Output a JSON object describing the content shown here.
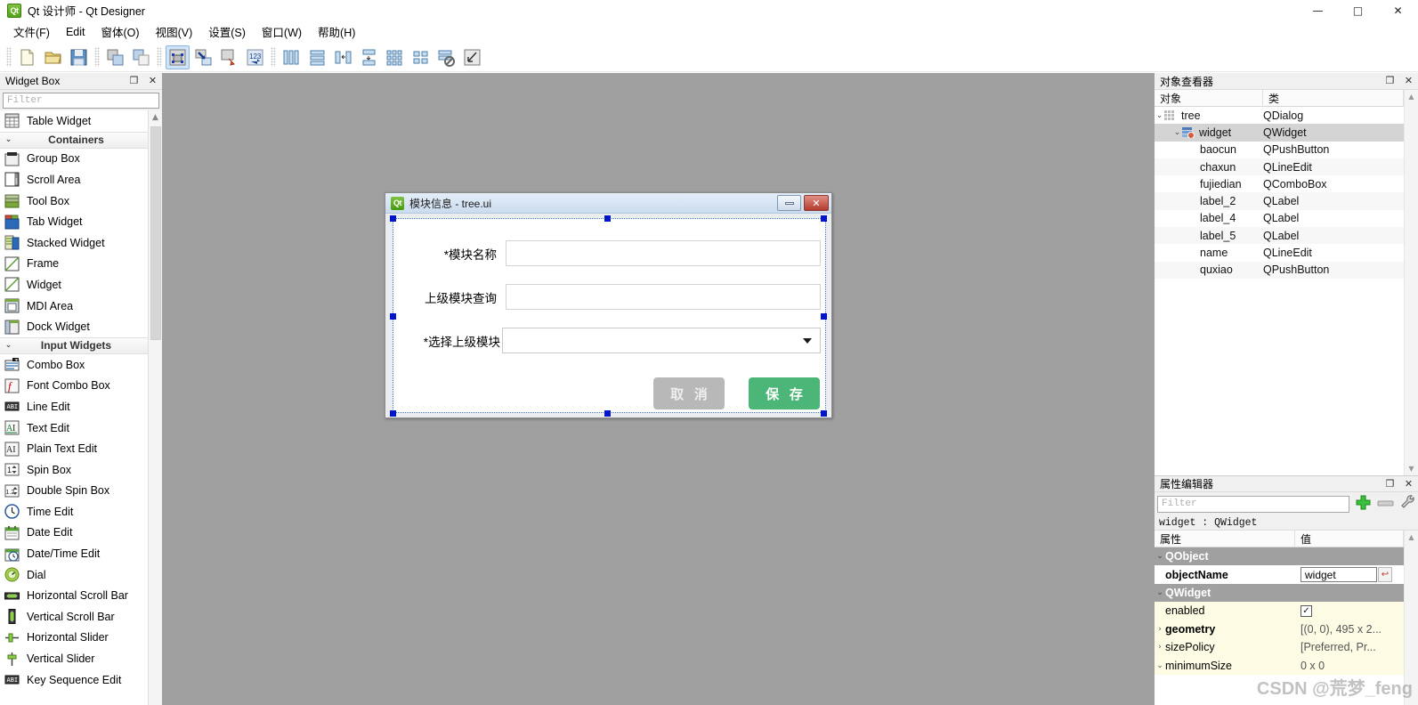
{
  "window": {
    "title": "Qt 设计师 - Qt Designer",
    "icon": "qt-logo-icon",
    "controls": {
      "minimize": "—",
      "maximize": "□",
      "close": "✕"
    }
  },
  "menubar": [
    {
      "label": "文件(F)"
    },
    {
      "label": "Edit"
    },
    {
      "label": "窗体(O)"
    },
    {
      "label": "视图(V)"
    },
    {
      "label": "设置(S)"
    },
    {
      "label": "窗口(W)"
    },
    {
      "label": "帮助(H)"
    }
  ],
  "toolbar": {
    "groups": [
      {
        "icons": [
          "new-file-icon",
          "open-folder-icon",
          "save-icon"
        ]
      },
      {
        "icons": [
          "copy-icon",
          "paste-icon"
        ]
      },
      {
        "icons": [
          "edit-widgets-icon",
          "edit-signals-slots-icon",
          "edit-buddies-icon",
          "edit-tab-order-icon"
        ]
      },
      {
        "icons": [
          "layout-horizontally-icon",
          "layout-vertically-icon",
          "layout-in-splitter-h-icon",
          "layout-in-splitter-v-icon",
          "layout-grid-icon",
          "layout-form-icon",
          "break-layout-icon",
          "adjust-size-icon"
        ]
      }
    ],
    "active_icon": "edit-widgets-icon"
  },
  "widget_box": {
    "title": "Widget Box",
    "float_label": "❐",
    "close_label": "✕",
    "filter_placeholder": "Filter",
    "items": [
      {
        "label": "Table Widget",
        "icon": "table-widget-icon",
        "type": "item"
      },
      {
        "label": "Containers",
        "icon": "chevron-down-icon",
        "type": "category"
      },
      {
        "label": "Group Box",
        "icon": "group-box-icon",
        "type": "item"
      },
      {
        "label": "Scroll Area",
        "icon": "scroll-area-icon",
        "type": "item"
      },
      {
        "label": "Tool Box",
        "icon": "tool-box-icon",
        "type": "item"
      },
      {
        "label": "Tab Widget",
        "icon": "tab-widget-icon",
        "type": "item"
      },
      {
        "label": "Stacked Widget",
        "icon": "stacked-widget-icon",
        "type": "item"
      },
      {
        "label": "Frame",
        "icon": "frame-icon",
        "type": "item"
      },
      {
        "label": "Widget",
        "icon": "widget-icon",
        "type": "item"
      },
      {
        "label": "MDI Area",
        "icon": "mdi-area-icon",
        "type": "item"
      },
      {
        "label": "Dock Widget",
        "icon": "dock-widget-icon",
        "type": "item"
      },
      {
        "label": "Input Widgets",
        "icon": "chevron-down-icon",
        "type": "category"
      },
      {
        "label": "Combo Box",
        "icon": "combo-box-icon",
        "type": "item"
      },
      {
        "label": "Font Combo Box",
        "icon": "font-combo-box-icon",
        "type": "item"
      },
      {
        "label": "Line Edit",
        "icon": "line-edit-icon",
        "type": "item"
      },
      {
        "label": "Text Edit",
        "icon": "text-edit-icon",
        "type": "item"
      },
      {
        "label": "Plain Text Edit",
        "icon": "plain-text-edit-icon",
        "type": "item"
      },
      {
        "label": "Spin Box",
        "icon": "spin-box-icon",
        "type": "item"
      },
      {
        "label": "Double Spin Box",
        "icon": "double-spin-box-icon",
        "type": "item"
      },
      {
        "label": "Time Edit",
        "icon": "time-edit-icon",
        "type": "item"
      },
      {
        "label": "Date Edit",
        "icon": "date-edit-icon",
        "type": "item"
      },
      {
        "label": "Date/Time Edit",
        "icon": "date-time-edit-icon",
        "type": "item"
      },
      {
        "label": "Dial",
        "icon": "dial-icon",
        "type": "item"
      },
      {
        "label": "Horizontal Scroll Bar",
        "icon": "horizontal-scroll-bar-icon",
        "type": "item"
      },
      {
        "label": "Vertical Scroll Bar",
        "icon": "vertical-scroll-bar-icon",
        "type": "item"
      },
      {
        "label": "Horizontal Slider",
        "icon": "horizontal-slider-icon",
        "type": "item"
      },
      {
        "label": "Vertical Slider",
        "icon": "vertical-slider-icon",
        "type": "item"
      },
      {
        "label": "Key Sequence Edit",
        "icon": "key-sequence-edit-icon",
        "type": "item"
      }
    ]
  },
  "form": {
    "title": "模块信息 - tree.ui",
    "icon": "qt-logo-icon",
    "minimize_label": "",
    "close_label": "✕",
    "fields": [
      {
        "label": "*模块名称",
        "value": "",
        "kind": "lineedit"
      },
      {
        "label": "上级模块查询",
        "value": "",
        "kind": "lineedit"
      },
      {
        "label": "*选择上级模块",
        "value": "",
        "kind": "combobox"
      }
    ],
    "buttons": {
      "cancel": "取 消",
      "save": "保 存",
      "cancel_color": "#b8b8b8",
      "save_color": "#4bb678"
    }
  },
  "object_inspector": {
    "title": "对象查看器",
    "float_label": "❐",
    "close_label": "✕",
    "columns": [
      "对象",
      "类"
    ],
    "rows": [
      {
        "name": "tree",
        "class": "QDialog",
        "depth": 0,
        "chevron": "⌄",
        "icon": "grid-icon",
        "selected": false
      },
      {
        "name": "widget",
        "class": "QWidget",
        "depth": 1,
        "chevron": "⌄",
        "icon": "widget-layout-icon",
        "selected": true
      },
      {
        "name": "baocun",
        "class": "QPushButton",
        "depth": 2,
        "chevron": "",
        "icon": "",
        "selected": false
      },
      {
        "name": "chaxun",
        "class": "QLineEdit",
        "depth": 2,
        "chevron": "",
        "icon": "",
        "selected": false
      },
      {
        "name": "fujiedian",
        "class": "QComboBox",
        "depth": 2,
        "chevron": "",
        "icon": "",
        "selected": false
      },
      {
        "name": "label_2",
        "class": "QLabel",
        "depth": 2,
        "chevron": "",
        "icon": "",
        "selected": false
      },
      {
        "name": "label_4",
        "class": "QLabel",
        "depth": 2,
        "chevron": "",
        "icon": "",
        "selected": false
      },
      {
        "name": "label_5",
        "class": "QLabel",
        "depth": 2,
        "chevron": "",
        "icon": "",
        "selected": false
      },
      {
        "name": "name",
        "class": "QLineEdit",
        "depth": 2,
        "chevron": "",
        "icon": "",
        "selected": false
      },
      {
        "name": "quxiao",
        "class": "QPushButton",
        "depth": 2,
        "chevron": "",
        "icon": "",
        "selected": false
      }
    ]
  },
  "property_editor": {
    "title": "属性编辑器",
    "float_label": "❐",
    "close_label": "✕",
    "filter_placeholder": "Filter",
    "selected_object": "widget : QWidget",
    "tool_icons": [
      "add-icon",
      "remove-icon",
      "configure-icon",
      "chevron-down-icon"
    ],
    "columns": [
      "属性",
      "值"
    ],
    "rows": [
      {
        "key": "QObject",
        "value": "",
        "style": "group",
        "chevron": "⌄"
      },
      {
        "key": "objectName",
        "value": "widget",
        "style": "edit",
        "chevron": ""
      },
      {
        "key": "QWidget",
        "value": "",
        "style": "group",
        "chevron": "⌄"
      },
      {
        "key": "enabled",
        "value": "✓",
        "style": "check",
        "chevron": ""
      },
      {
        "key": "geometry",
        "value": "[(0, 0), 495 x 2...",
        "style": "expandable-bold",
        "chevron": "›"
      },
      {
        "key": "sizePolicy",
        "value": "[Preferred, Pr...",
        "style": "expandable",
        "chevron": "›"
      },
      {
        "key": "minimumSize",
        "value": "0 x 0",
        "style": "expanded",
        "chevron": "⌄"
      }
    ]
  },
  "watermark": "CSDN @荒梦_feng"
}
